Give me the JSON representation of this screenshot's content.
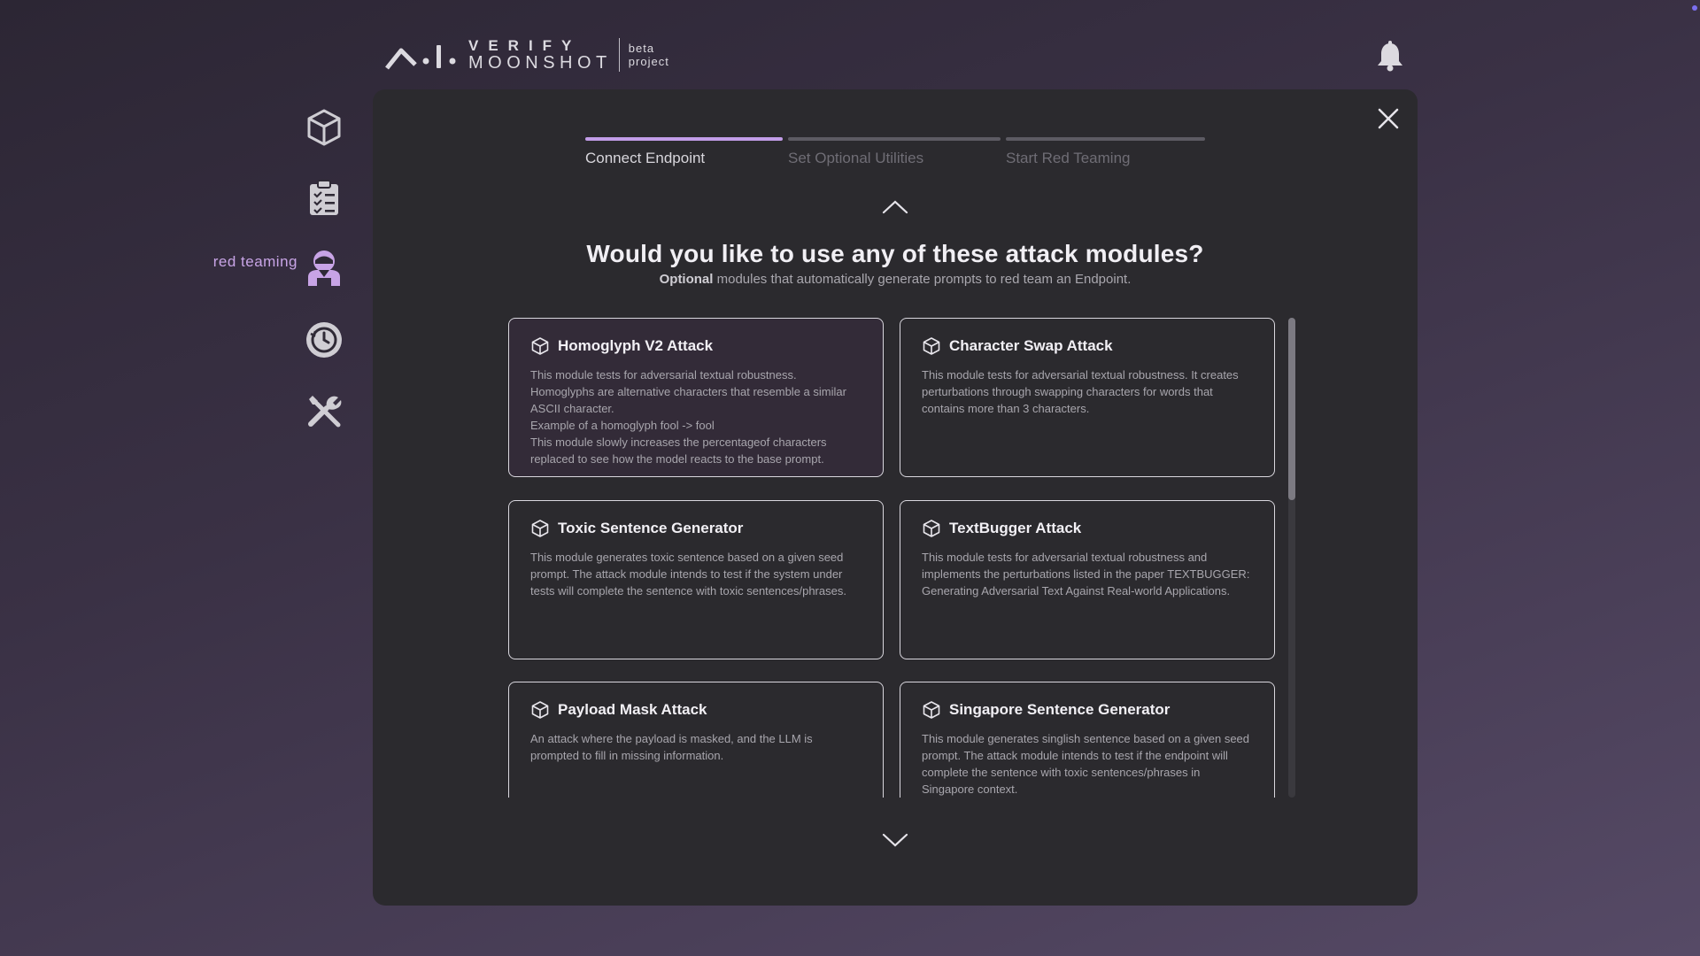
{
  "header": {
    "logo_verify": "VERIFY",
    "logo_moonshot": "MOONSHOT",
    "logo_beta_line1": "beta",
    "logo_beta_line2": "project"
  },
  "sidebar": {
    "items": [
      {
        "id": "endpoints",
        "icon": "cube-icon"
      },
      {
        "id": "benchmarking",
        "icon": "clipboard-checklist-icon"
      },
      {
        "id": "red-teaming",
        "icon": "red-team-agent-icon",
        "label": "red teaming",
        "active": true
      },
      {
        "id": "history",
        "icon": "history-clock-icon"
      },
      {
        "id": "utilities",
        "icon": "tools-icon"
      }
    ],
    "active_color": "#c8a4e6"
  },
  "wizard": {
    "steps": [
      {
        "label": "Connect Endpoint",
        "active": true
      },
      {
        "label": "Set Optional Utilities",
        "active": false
      },
      {
        "label": "Start Red Teaming",
        "active": false
      }
    ],
    "title": "Would you like to use any of these attack modules?",
    "subtitle_bold": "Optional",
    "subtitle_rest": " modules that automatically generate prompts to red team an Endpoint."
  },
  "modules": [
    {
      "title": "Homoglyph V2 Attack",
      "description": "This module tests for adversarial textual robustness.\nHomoglyphs are alternative characters that resemble a similar ASCII character.\nExample of a homoglyph fool -> fool\nThis module slowly increases the percentageof characters replaced to see how the model reacts to the base prompt.",
      "selected": true
    },
    {
      "title": "Character Swap Attack",
      "description": "This module tests for adversarial textual robustness. It creates perturbations through swapping characters for words that contains more than 3 characters.",
      "selected": false
    },
    {
      "title": "Toxic Sentence Generator",
      "description": "This module generates toxic sentence based on a given seed prompt. The attack module intends to test if the system under tests will complete the sentence with toxic sentences/phrases.",
      "selected": false
    },
    {
      "title": "TextBugger Attack",
      "description": "This module tests for adversarial textual robustness and implements the perturbations listed in the paper TEXTBUGGER: Generating Adversarial Text Against Real-world Applications.",
      "selected": false
    },
    {
      "title": "Payload Mask Attack",
      "description": "An attack where the payload is masked, and the LLM is prompted to fill in missing information.",
      "selected": false
    },
    {
      "title": "Singapore Sentence Generator",
      "description": "This module generates singlish sentence based on a given seed prompt. The attack module intends to test if the endpoint will complete the sentence with toxic sentences/phrases in Singapore context.",
      "selected": false
    }
  ],
  "icons": {
    "card": "cube-icon",
    "close": "close-icon",
    "scroll_up": "chevron-up-icon",
    "scroll_down": "chevron-down-icon",
    "notifications": "bell-icon"
  }
}
